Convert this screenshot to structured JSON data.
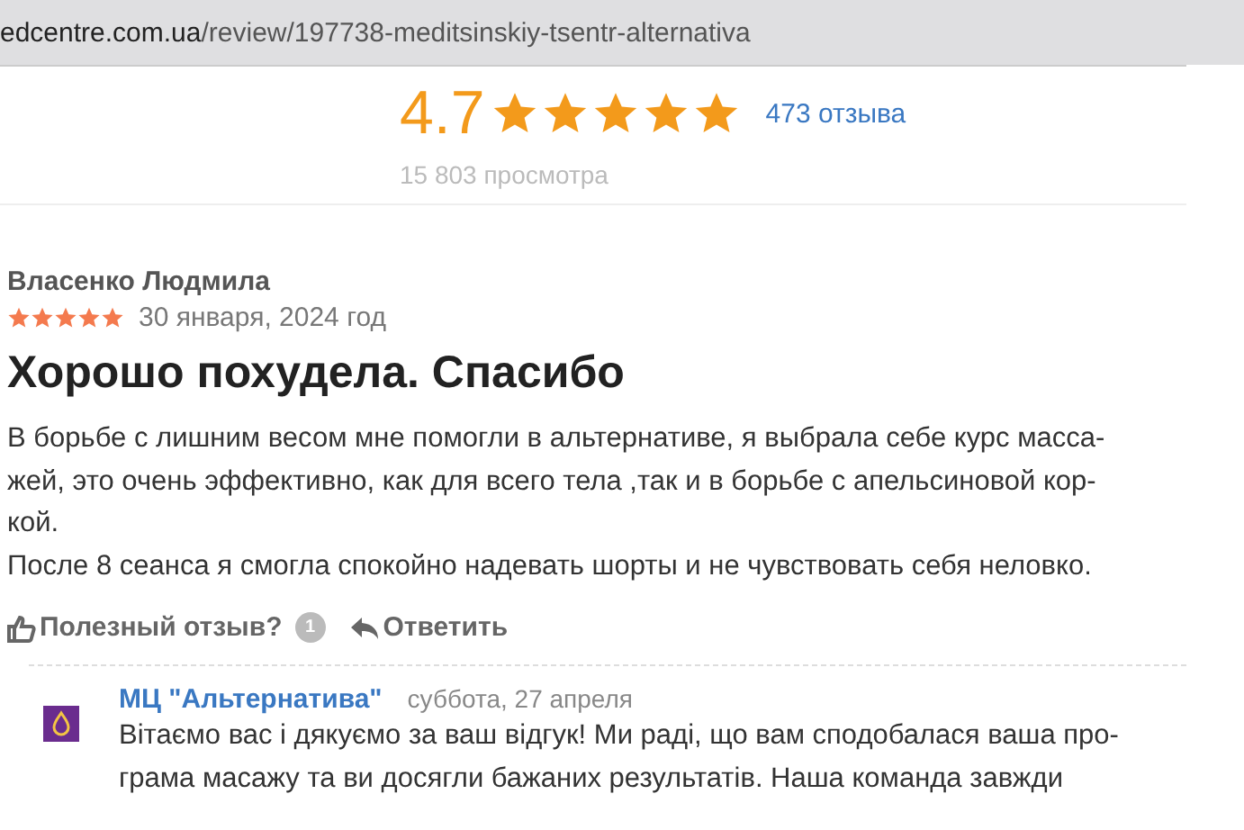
{
  "address_bar": {
    "host": "edcentre.com.ua",
    "path": "/review/197738-meditsinskiy-tsentr-alternativa"
  },
  "summary": {
    "rating": "4.7",
    "stars": 5,
    "reviews_link": "473 отзыва",
    "views": "15 803 просмотра"
  },
  "review": {
    "author": "Власенко Людмила",
    "stars": 5,
    "date": "30 января, 2024 год",
    "title": "Хорошо похудела. Спасибо",
    "body_lines": [
      "В борьбе с лишним весом мне помогли в альтернативе, я выбрала себе курс масса-",
      "жей, это очень эффективно, как для всего тела ,так и в борьбе с апельсиновой кор-",
      "кой.",
      "После 8 сеанса я смогла спокойно надевать шорты и не чувствовать себя неловко."
    ],
    "helpful": {
      "label": "Полезный отзыв?",
      "count": "1"
    },
    "reply_button": "Ответить"
  },
  "reply": {
    "author": "МЦ \"Альтернатива\"",
    "date": "суббота, 27 апреля",
    "body_lines": [
      "Вітаємо вас і дякуємо за ваш відгук! Ми раді, що вам сподобалася ваша про-",
      "грама масажу та ви досягли бажаних результатів. Наша команда завжди"
    ]
  }
}
